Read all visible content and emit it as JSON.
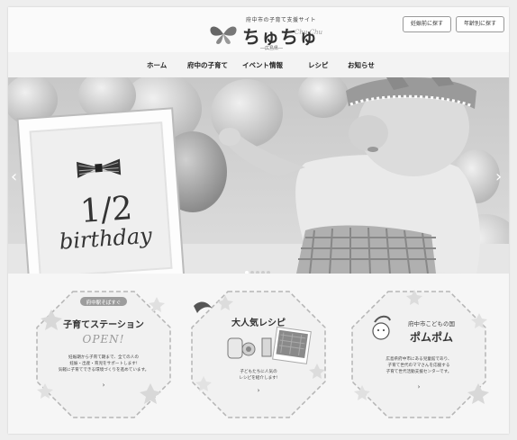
{
  "header": {
    "logo_tagline": "府中市の子育て支援サイト",
    "logo_name": "ちゅちゅ",
    "logo_script": "Chu Chu",
    "logo_sub": "―広島県―",
    "buttons": [
      "妊娠前に探す",
      "年齢別に探す"
    ]
  },
  "nav": {
    "items": [
      "ホーム",
      "府中の子育て",
      "イベント情報",
      "レシピ",
      "お知らせ"
    ]
  },
  "hero": {
    "sign_line1": "1/2",
    "sign_line2": "birthday",
    "prev": "‹",
    "next": "›"
  },
  "cards": [
    {
      "small": "府中駅そばすぐ",
      "title": "子育てステーション",
      "highlight": "OPEN!",
      "desc": [
        "妊娠期から子育て期まで、全ての人の",
        "妊娠・出産・育児をサポートします!",
        "気軽に子育てできる環境づくりを進めています。"
      ],
      "chevron": "›"
    },
    {
      "small": "",
      "title": "大人気レシピ",
      "highlight": "",
      "desc": [
        "子どもたちに人気の",
        "レシピを紹介します!"
      ],
      "chevron": "›"
    },
    {
      "small": "府中市こどもの国",
      "title": "ポムポム",
      "highlight": "",
      "desc": [
        "広島県府中市にある児童館であり、",
        "子育て世代のママさんを応援する",
        "子育て世代活動支援センターです。"
      ],
      "chevron": "›"
    }
  ]
}
